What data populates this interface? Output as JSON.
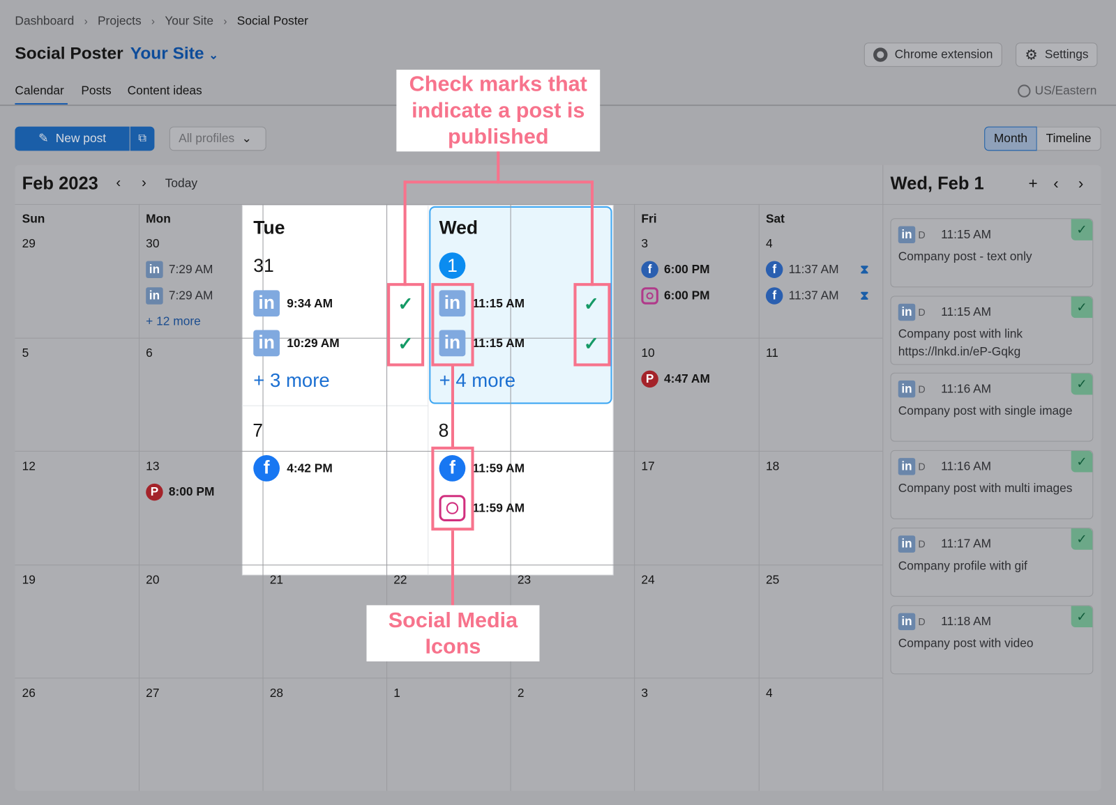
{
  "breadcrumb": [
    "Dashboard",
    "Projects",
    "Your Site",
    "Social Poster"
  ],
  "header": {
    "title": "Social Poster",
    "project": "Your Site",
    "chrome_extension": "Chrome extension",
    "settings": "Settings",
    "timezone": "US/Eastern"
  },
  "tabs": [
    "Calendar",
    "Posts",
    "Content ideas"
  ],
  "toolbar": {
    "new_post": "New post",
    "profiles": "All profiles",
    "view_month": "Month",
    "view_timeline": "Timeline"
  },
  "calendar": {
    "month": "Feb 2023",
    "today": "Today",
    "weekdays": [
      "Sun",
      "Mon",
      "",
      "",
      "",
      "Fri",
      "Sat"
    ],
    "weeks": [
      [
        "29",
        "30",
        "",
        "",
        "",
        "3",
        "4"
      ],
      [
        "5",
        "6",
        "",
        "",
        "",
        "10",
        "11"
      ],
      [
        "12",
        "13",
        "",
        "",
        "",
        "17",
        "18"
      ],
      [
        "19",
        "20",
        "21",
        "22",
        "23",
        "24",
        "25"
      ],
      [
        "26",
        "27",
        "28",
        "1",
        "2",
        "3",
        "4"
      ]
    ],
    "cells": [
      {
        "week": 0,
        "day": 1,
        "posts": [
          {
            "network": "linkedin",
            "time": "7:29 AM"
          },
          {
            "network": "linkedin",
            "time": "7:29 AM"
          }
        ],
        "more": "+ 12 more"
      },
      {
        "week": 0,
        "day": 5,
        "posts": [
          {
            "network": "facebook",
            "time": "6:00 PM"
          },
          {
            "network": "instagram",
            "time": "6:00 PM"
          }
        ]
      },
      {
        "week": 0,
        "day": 6,
        "posts": [
          {
            "network": "facebook",
            "time": "11:37 AM",
            "status": "scheduled"
          },
          {
            "network": "facebook",
            "time": "11:37 AM",
            "status": "scheduled"
          }
        ]
      },
      {
        "week": 1,
        "day": 5,
        "posts": [
          {
            "network": "pinterest",
            "time": "4:47 AM"
          }
        ]
      },
      {
        "week": 2,
        "day": 1,
        "posts": [
          {
            "network": "pinterest",
            "time": "8:00 PM"
          }
        ]
      }
    ]
  },
  "popout": {
    "tue": {
      "name": "Tue",
      "date": "31",
      "posts": [
        {
          "network": "linkedin",
          "time": "9:34 AM",
          "published": true
        },
        {
          "network": "linkedin",
          "time": "10:29 AM",
          "published": true
        }
      ],
      "more": "+ 3 more",
      "next_date": "7",
      "next_posts": [
        {
          "network": "facebook",
          "time": "4:42 PM"
        }
      ]
    },
    "wed": {
      "name": "Wed",
      "date": "1",
      "posts": [
        {
          "network": "linkedin",
          "time": "11:15 AM",
          "published": true
        },
        {
          "network": "linkedin",
          "time": "11:15 AM",
          "published": true
        }
      ],
      "more": "+ 4 more",
      "next_date": "8",
      "next_posts": [
        {
          "network": "facebook",
          "time": "11:59 AM"
        },
        {
          "network": "instagram",
          "time": "11:59 AM"
        }
      ]
    }
  },
  "side_panel": {
    "title": "Wed, Feb 1",
    "posts": [
      {
        "profile": "D",
        "time": "11:15 AM",
        "text": "Company post - text only"
      },
      {
        "profile": "D",
        "time": "11:15 AM",
        "text": "Company post with link https://lnkd.in/eP-Gqkg"
      },
      {
        "profile": "D",
        "time": "11:16 AM",
        "text": "Company post with single image"
      },
      {
        "profile": "D",
        "time": "11:16 AM",
        "text": "Company post with multi images"
      },
      {
        "profile": "D",
        "time": "11:17 AM",
        "text": "Company profile with gif"
      },
      {
        "profile": "D",
        "time": "11:18 AM",
        "text": "Company post with video"
      }
    ]
  },
  "annotations": {
    "checkmarks": "Check marks that indicate a post is published",
    "icons": "Social Media Icons"
  },
  "colors": {
    "accent": "#006dca",
    "annotation": "#f7738c",
    "published": "#159a66",
    "selected_day": "#e8f6fd"
  }
}
